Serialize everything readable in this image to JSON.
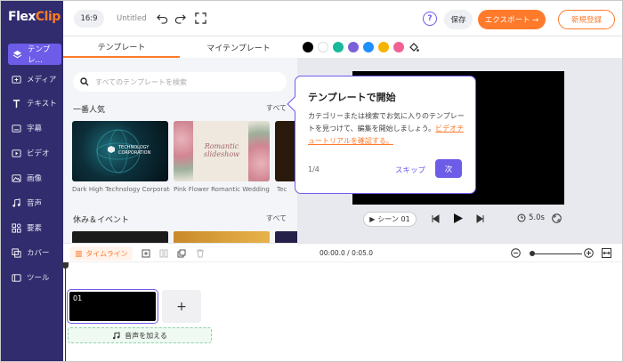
{
  "app": {
    "logo_flex": "Flex",
    "logo_clip": "Clip"
  },
  "sidebar": {
    "items": [
      {
        "label": "テンプレ…",
        "icon": "template-icon",
        "active": true
      },
      {
        "label": "メディア",
        "icon": "media-icon"
      },
      {
        "label": "テキスト",
        "icon": "text-icon"
      },
      {
        "label": "字幕",
        "icon": "subtitle-icon"
      },
      {
        "label": "ビデオ",
        "icon": "video-icon"
      },
      {
        "label": "画像",
        "icon": "image-icon"
      },
      {
        "label": "音声",
        "icon": "music-icon"
      },
      {
        "label": "要素",
        "icon": "elements-icon"
      },
      {
        "label": "カバー",
        "icon": "cover-icon"
      },
      {
        "label": "ツール",
        "icon": "tool-icon"
      }
    ]
  },
  "header": {
    "ratio": "16:9",
    "title": "Untitled",
    "save": "保存",
    "export": "エクスポート →",
    "register": "新規登録",
    "help": "?"
  },
  "panel": {
    "tabs": [
      "テンプレート",
      "マイテンプレート"
    ],
    "search_placeholder": "すべてのテンプレートを検索",
    "section1": "一番人気",
    "section2": "休み＆イベント",
    "all": "すべて",
    "thumbs": [
      {
        "caption": "Dark High Technology Corporate...",
        "text": "TECHNOLOGY CORPORATION"
      },
      {
        "caption": "Pink Flower Romantic Wedding ...",
        "text": "Romantic slideshow"
      },
      {
        "caption": "Tec"
      }
    ]
  },
  "colors": [
    "#000000",
    "#ffffff",
    "#18b99a",
    "#7b61d9",
    "#1e90ff",
    "#f5b400",
    "#f06292"
  ],
  "preview": {
    "scene": "シーン 01",
    "duration": "5.0s"
  },
  "popup": {
    "title": "テンプレートで開始",
    "body": "カテゴリーまたは検索でお気に入りのテンプレートを見つけて、編集を開始しましょう。",
    "link": "ビデオチュートリアルを確認する。",
    "count": "1/4",
    "skip": "スキップ",
    "next": "次"
  },
  "timeline": {
    "label": "タイムライン",
    "time": "00:00.0 / 0:05.0",
    "clip_number": "01",
    "audio": "音声を加える"
  }
}
